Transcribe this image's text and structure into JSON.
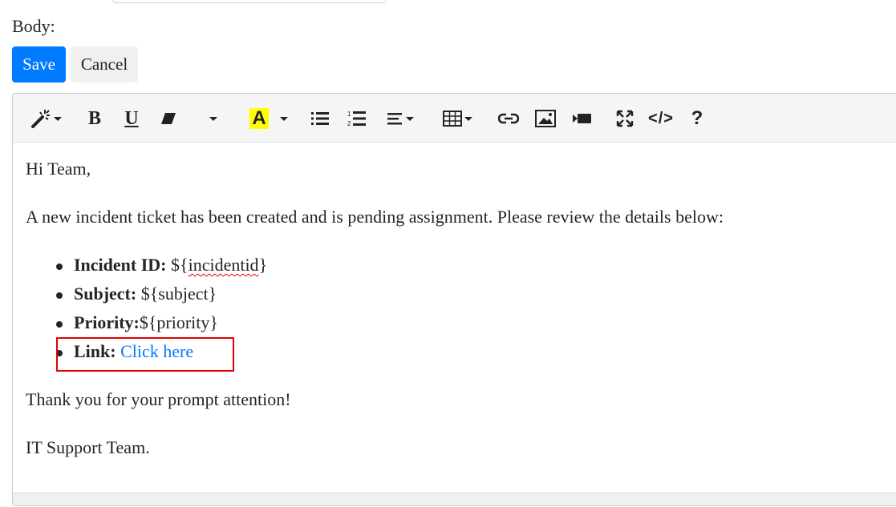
{
  "form": {
    "body_label": "Body:",
    "save_label": "Save",
    "cancel_label": "Cancel"
  },
  "toolbar": {
    "bold": "B",
    "underline": "U",
    "font_color": "A",
    "code_view": "</>",
    "help": "?",
    "highlight_color": "#ffff00"
  },
  "content": {
    "greeting": "Hi Team,",
    "intro": "A new incident ticket has been created and is pending assignment. Please review the details below:",
    "items": [
      {
        "label": "Incident ID:",
        "value": " ${",
        "value_mid": "incidentid",
        "value_end": "}"
      },
      {
        "label": "Subject:",
        "value": " ${subject}"
      },
      {
        "label": "Priority:",
        "value": "${priority}"
      },
      {
        "label": "Link:",
        "value": " ",
        "link_text": "Click here"
      }
    ],
    "thanks": "Thank you for your prompt attention!",
    "signature": "IT Support Team."
  },
  "colors": {
    "primary": "#007bff",
    "highlight_box": "#e00000"
  }
}
